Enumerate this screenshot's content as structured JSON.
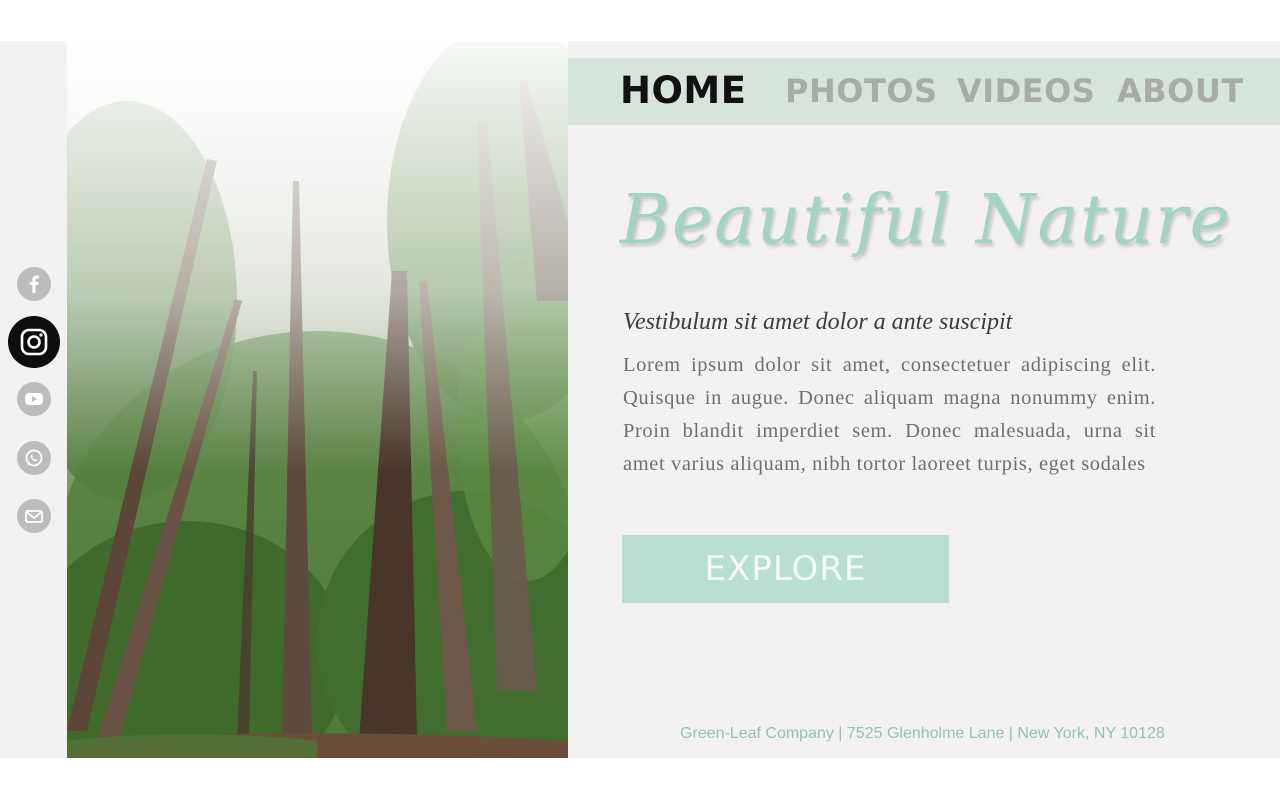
{
  "social": {
    "icons": [
      "facebook-icon",
      "instagram-icon",
      "youtube-icon",
      "whatsapp-icon",
      "mail-icon"
    ],
    "active": "instagram-icon",
    "icon_color": "#bdbbbd",
    "active_color": "#0e0e0e"
  },
  "nav": {
    "items": [
      {
        "label": "HOME",
        "active": true
      },
      {
        "label": "PHOTOS",
        "active": false
      },
      {
        "label": "VIDEOS",
        "active": false
      },
      {
        "label": "ABOUT",
        "active": false
      }
    ],
    "bar_color": "#d7e4dc"
  },
  "hero": {
    "headline": "Beautiful Nature",
    "subheading": "Vestibulum sit amet dolor a ante suscipit",
    "body": "Lorem ipsum dolor sit amet, consectetuer adipiscing elit. Quisque in augue. Donec aliquam magna nonummy enim. Proin blandit imperdiet sem. Donec malesuada, urna sit amet varius aliquam, nibh tortor laoreet turpis, eget sodales",
    "button_label": "EXPLORE",
    "accent_color": "#a3d4c2"
  },
  "footer": {
    "text": "Green-Leaf Company  |  7525 Glenholme Lane  |  New York, NY 10128"
  }
}
